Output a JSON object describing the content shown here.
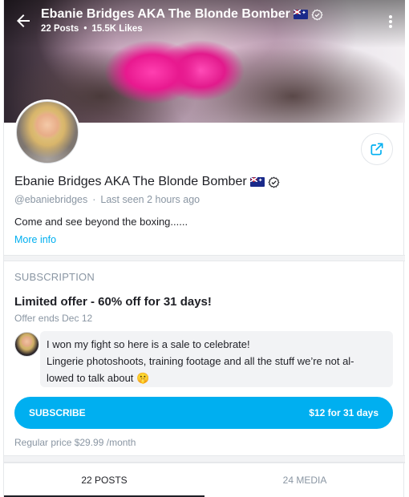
{
  "header": {
    "title": "Ebanie Bridges AKA The Blonde Bomber",
    "posts": "22 Posts",
    "separator": "•",
    "likes": "15.5K Likes"
  },
  "profile": {
    "name": "Ebanie Bridges AKA The Blonde Bomber",
    "handle": "@ebaniebridges",
    "separator": "·",
    "last_seen": "Last seen 2 hours ago",
    "bio": "Come and see beyond the boxing......",
    "more_info": "More info"
  },
  "subscription": {
    "heading": "Subscription",
    "offer_title": "Limited offer - 60% off for 31 days!",
    "offer_ends": "Offer ends Dec 12",
    "message_line1": "I won my fight so here is a sale to celebrate!",
    "message_line2": "Lingerie photoshoots, training footage and all the stuff we’re not al-",
    "message_line3": "lowed to talk about 🤫",
    "button_label": "Subscribe",
    "button_price": "$12 for 31 days",
    "regular_price": "Regular price $29.99 /month"
  },
  "tabs": [
    {
      "label": "22 POSTS",
      "active": true
    },
    {
      "label": "24 MEDIA",
      "active": false
    }
  ],
  "colors": {
    "accent": "#00aff0",
    "muted_text": "#8a96a3",
    "primary_text": "#1f2026"
  },
  "icons": {
    "back": "arrow-left-icon",
    "menu": "kebab-menu-icon",
    "verified": "verified-badge-icon",
    "flag": "australia-flag-icon",
    "share": "share-icon"
  }
}
